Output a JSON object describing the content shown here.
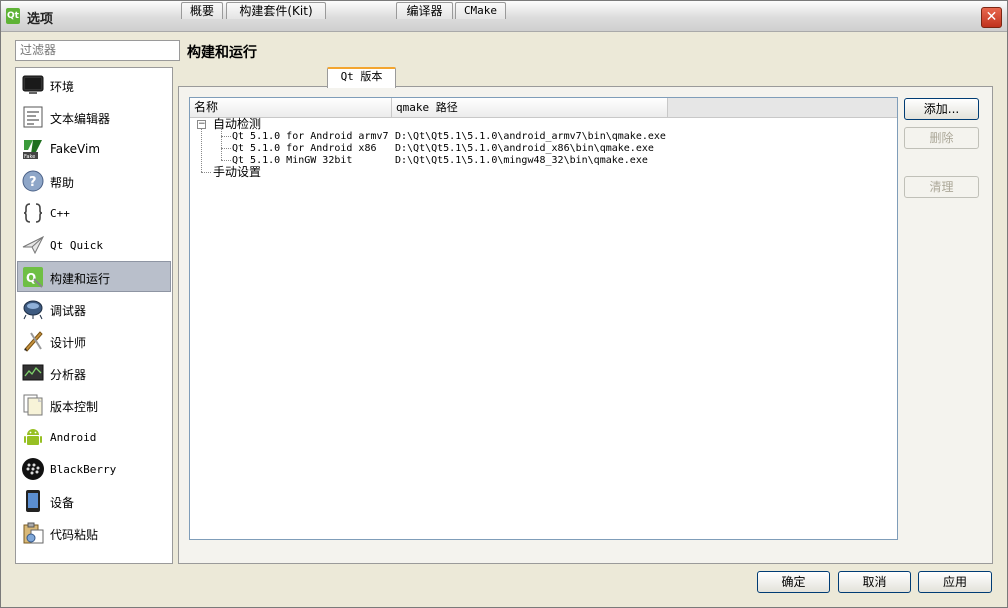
{
  "window": {
    "title": "选项",
    "app_icon_text": "Qt",
    "close_glyph": "✕"
  },
  "filter": {
    "placeholder": "过滤器"
  },
  "sidebar": {
    "items": [
      {
        "label": "环境",
        "icon": "monitor-icon"
      },
      {
        "label": "文本编辑器",
        "icon": "text-editor-icon"
      },
      {
        "label": "FakeVim",
        "icon": "fakevim-icon"
      },
      {
        "label": "帮助",
        "icon": "help-icon"
      },
      {
        "label": "C++",
        "icon": "cpp-braces-icon"
      },
      {
        "label": "Qt Quick",
        "icon": "qt-quick-icon"
      },
      {
        "label": "构建和运行",
        "icon": "build-run-icon",
        "selected": true
      },
      {
        "label": "调试器",
        "icon": "debugger-icon"
      },
      {
        "label": "设计师",
        "icon": "designer-icon"
      },
      {
        "label": "分析器",
        "icon": "analyzer-icon"
      },
      {
        "label": "版本控制",
        "icon": "version-control-icon"
      },
      {
        "label": "Android",
        "icon": "android-icon"
      },
      {
        "label": "BlackBerry",
        "icon": "blackberry-icon"
      },
      {
        "label": "设备",
        "icon": "device-icon"
      },
      {
        "label": "代码粘贴",
        "icon": "code-paste-icon"
      }
    ]
  },
  "page": {
    "title": "构建和运行"
  },
  "tabs": [
    {
      "label": "概要"
    },
    {
      "label": "构建套件(Kit)"
    },
    {
      "label": "Qt 版本",
      "active": true
    },
    {
      "label": "编译器"
    },
    {
      "label": "CMake"
    }
  ],
  "tree": {
    "columns": [
      "名称",
      "qmake 路径"
    ],
    "groups": [
      {
        "label": "自动检测",
        "expander": "−",
        "rows": [
          {
            "name": "Qt 5.1.0 for Android armv7",
            "path": "D:\\Qt\\Qt5.1\\5.1.0\\android_armv7\\bin\\qmake.exe"
          },
          {
            "name": "Qt 5.1.0 for Android x86",
            "path": "D:\\Qt\\Qt5.1\\5.1.0\\android_x86\\bin\\qmake.exe"
          },
          {
            "name": "Qt 5.1.0 MinGW 32bit",
            "path": "D:\\Qt\\Qt5.1\\5.1.0\\mingw48_32\\bin\\qmake.exe"
          }
        ]
      },
      {
        "label": "手动设置",
        "rows": []
      }
    ]
  },
  "side_buttons": {
    "add": "添加...",
    "remove": "删除",
    "clean": "清理"
  },
  "dialog_buttons": {
    "ok": "确定",
    "cancel": "取消",
    "apply": "应用"
  },
  "colors": {
    "accent_tab": "#f3a530",
    "selection": "#b9bfcb",
    "button_border": "#003c74"
  }
}
